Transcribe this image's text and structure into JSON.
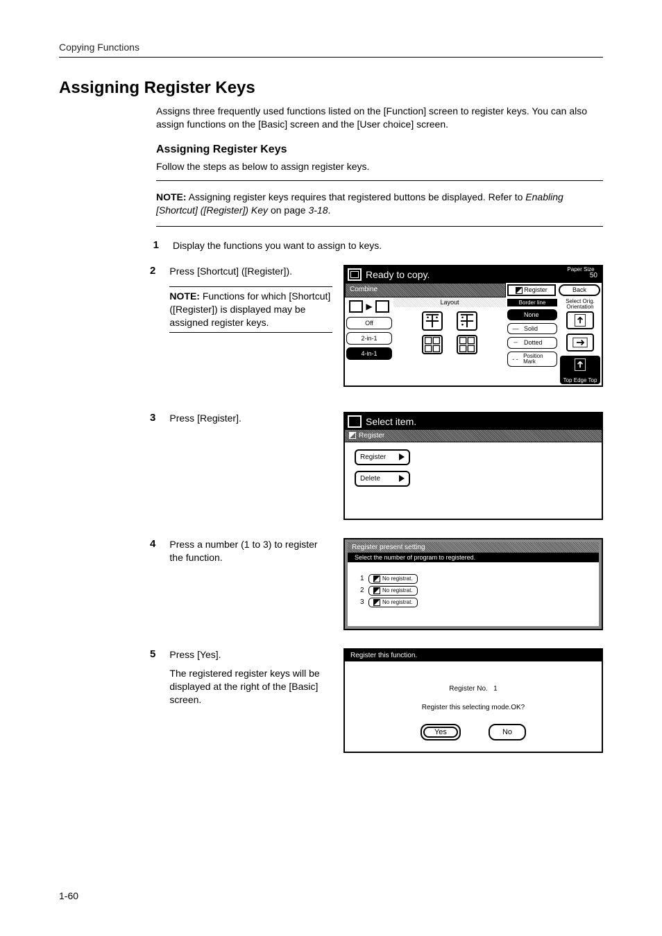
{
  "header": {
    "running": "Copying Functions"
  },
  "title": "Assigning Register Keys",
  "intro": "Assigns three frequently used functions listed on the [Function] screen to register keys. You can also assign functions on the [Basic] screen and the [User choice] screen.",
  "sub": {
    "heading": "Assigning Register Keys",
    "lead": "Follow the steps as below to assign register keys."
  },
  "note1": {
    "label": "NOTE:",
    "text_a": " Assigning register keys requires that registered buttons be displayed. Refer to ",
    "ref": "Enabling [Shortcut] ([Register]) Key",
    "text_b": " on page ",
    "page": "3-18",
    "period": "."
  },
  "steps": {
    "s1": {
      "num": "1",
      "text": "Display the functions you want to assign to keys."
    },
    "s2": {
      "num": "2",
      "text": "Press [Shortcut] ([Register]).",
      "note_label": "NOTE:",
      "note_text": " Functions for which [Shortcut] ([Register]) is displayed may be assigned register keys."
    },
    "s3": {
      "num": "3",
      "text": "Press [Register]."
    },
    "s4": {
      "num": "4",
      "text": "Press a number (1 to 3) to register the function."
    },
    "s5": {
      "num": "5",
      "text": "Press [Yes].",
      "text2": "The registered register keys will be displayed at the right of the [Basic] screen."
    }
  },
  "screen1": {
    "title": "Ready to copy.",
    "paper_size_label": "Paper Size",
    "paper_size_value": "50",
    "tab": "Combine",
    "register_btn": "Register",
    "back_btn": "Back",
    "layout_label": "Layout",
    "opts": {
      "off": "Off",
      "two": "2-in-1",
      "four": "4-in-1"
    },
    "border_label": "Border line",
    "border": {
      "none": "None",
      "solid": "Solid",
      "dotted": "Dotted",
      "mark": "Position Mark"
    },
    "orient_label": "Select Orig. Orientation",
    "top_edge": "Top Edge Top"
  },
  "screen2": {
    "title": "Select item.",
    "tab": "Register",
    "btn_register": "Register",
    "btn_delete": "Delete"
  },
  "screen3": {
    "title": "Register present setting",
    "subtitle": "Select the number of program to registered.",
    "rows": [
      {
        "n": "1",
        "label": "No registrat."
      },
      {
        "n": "2",
        "label": "No registrat."
      },
      {
        "n": "3",
        "label": "No registrat."
      }
    ]
  },
  "screen4": {
    "title": "Register this function.",
    "l1a": "Register No.",
    "l1b": "1",
    "l2": "Register this selecting mode.OK?",
    "yes": "Yes",
    "no": "No"
  },
  "page_number": "1-60"
}
